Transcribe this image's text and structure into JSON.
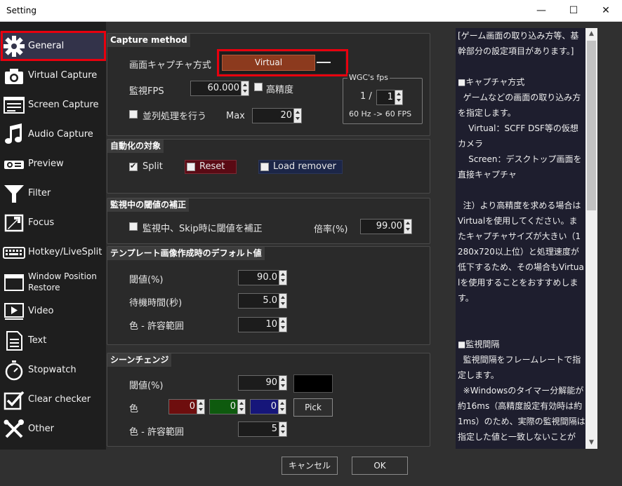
{
  "window": {
    "title": "Setting",
    "minimize": "—",
    "maximize": "☐",
    "close": "✕"
  },
  "sidebar": {
    "items": [
      {
        "label": "General",
        "icon": "gear-icon"
      },
      {
        "label": "Virtual Capture",
        "icon": "camera-icon"
      },
      {
        "label": "Screen Capture",
        "icon": "screen-icon"
      },
      {
        "label": "Audio Capture",
        "icon": "music-note-icon"
      },
      {
        "label": "Preview",
        "icon": "projector-icon"
      },
      {
        "label": "Filter",
        "icon": "filter-icon"
      },
      {
        "label": "Focus",
        "icon": "focus-icon"
      },
      {
        "label": "Hotkey/LiveSplit",
        "icon": "keyboard-icon"
      },
      {
        "label": "Window Position Restore",
        "icon": "window-icon"
      },
      {
        "label": "Video",
        "icon": "video-icon"
      },
      {
        "label": "Text",
        "icon": "text-icon"
      },
      {
        "label": "Stopwatch",
        "icon": "stopwatch-icon"
      },
      {
        "label": "Clear checker",
        "icon": "checkbox-icon"
      },
      {
        "label": "Other",
        "icon": "tools-icon"
      }
    ]
  },
  "capture": {
    "title": "Capture method",
    "method_label": "画面キャプチャ方式",
    "method_value": "Virtual",
    "fps_label": "監視FPS",
    "fps_value": "60.000",
    "high_precision_label": "高精度",
    "parallel_label": "並列処理を行う",
    "max_label": "Max",
    "max_value": "20",
    "wgc_title": "WGC's fps",
    "wgc_numerator": "1 /",
    "wgc_denominator": "1",
    "wgc_info": "60 Hz -> 60 FPS"
  },
  "automation": {
    "title": "自動化の対象",
    "split_label": "Split",
    "reset_label": "Reset",
    "load_remover_label": "Load remover"
  },
  "threshold_correction": {
    "title": "監視中の閾値の補正",
    "checkbox_label": "監視中、Skip時に閾値を補正",
    "ratio_label": "倍率(%)",
    "ratio_value": "99.00"
  },
  "template_defaults": {
    "title": "テンプレート画像作成時のデフォルト値",
    "threshold_label": "閾値(%)",
    "threshold_value": "90.0",
    "wait_label": "待機時間(秒)",
    "wait_value": "5.0",
    "color_tolerance_label": "色 - 許容範囲",
    "color_tolerance_value": "10"
  },
  "scene_change": {
    "title": "シーンチェンジ",
    "threshold_label": "閾値(%)",
    "threshold_value": "90",
    "color_label": "色",
    "r_value": "0",
    "g_value": "0",
    "b_value": "0",
    "pick_label": "Pick",
    "tolerance_label": "色 - 許容範囲",
    "tolerance_value": "5",
    "swatch_color": "#000000"
  },
  "description": {
    "text": "[ゲーム画面の取り込み方等、基幹部分の設定項目があります。]\n\n■キャプチャ方式\n  ゲームなどの画面の取り込み方を指定します。\n    Virtual：SCFF DSF等の仮想カメラ\n    Screen：デスクトップ画面を直接キャプチャ\n\n  注）より高精度を求める場合はVirtualを使用してください。またキャプチャサイズが大きい（1280x720以上位）と処理速度が低下するため、その場合もVirtualを使用することをおすすめします。\n\n\n■監視間隔\n  監視間隔をフレームレートで指定します。\n  ※Windowsのタイマー分解能が約16ms（高精度設定有効時は約1ms）のため、実際の監視間隔は指定した値と一致しないことが"
  },
  "footer": {
    "cancel_label": "キャンセル",
    "ok_label": "OK"
  },
  "colors": {
    "accent_red": "#e8000e",
    "virtual_button": "#8c3a1e",
    "reset_bg": "#5a0a14",
    "load_remover_bg": "#1c2648",
    "r_bg": "#6e0e0e",
    "g_bg": "#0e5a0e",
    "b_bg": "#16167a"
  }
}
